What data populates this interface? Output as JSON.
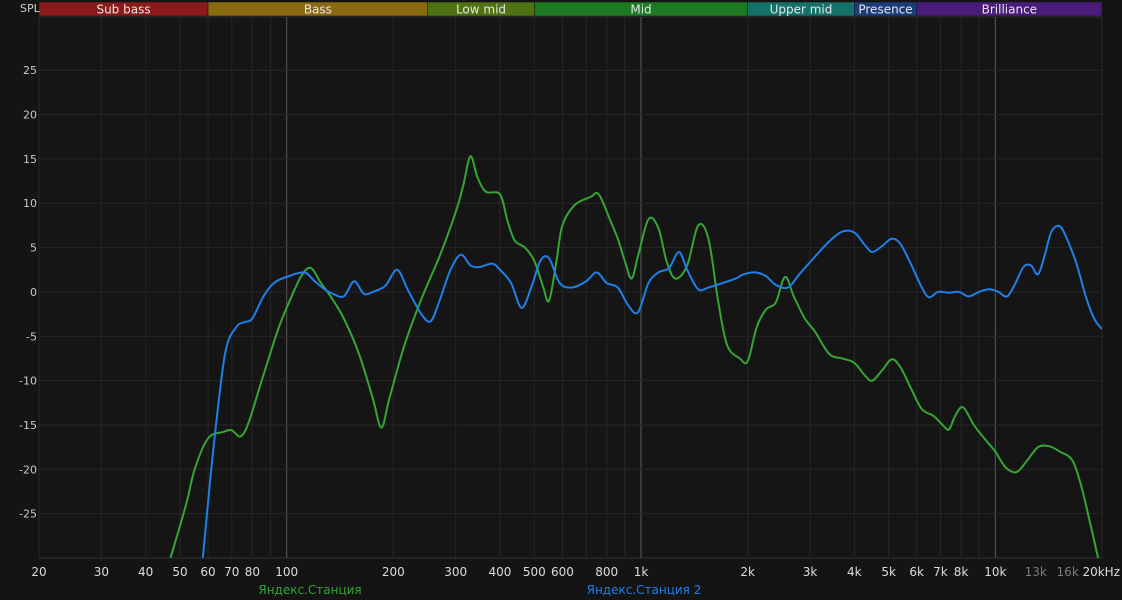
{
  "chart_data": {
    "type": "line",
    "y_axis_label": "SPL",
    "x_scale": "log",
    "x_range": [
      20,
      20000
    ],
    "y_range": [
      -30,
      31
    ],
    "y_ticks": [
      -25,
      -20,
      -15,
      -10,
      -5,
      0,
      5,
      10,
      15,
      20,
      25
    ],
    "x_ticks": [
      {
        "value": 20,
        "label": "20",
        "dim": false
      },
      {
        "value": 30,
        "label": "30",
        "dim": false
      },
      {
        "value": 40,
        "label": "40",
        "dim": false
      },
      {
        "value": 50,
        "label": "50",
        "dim": false
      },
      {
        "value": 60,
        "label": "60",
        "dim": false
      },
      {
        "value": 70,
        "label": "70",
        "dim": false
      },
      {
        "value": 80,
        "label": "80",
        "dim": false
      },
      {
        "value": 100,
        "label": "100",
        "dim": false
      },
      {
        "value": 200,
        "label": "200",
        "dim": false
      },
      {
        "value": 300,
        "label": "300",
        "dim": false
      },
      {
        "value": 400,
        "label": "400",
        "dim": false
      },
      {
        "value": 500,
        "label": "500",
        "dim": false
      },
      {
        "value": 600,
        "label": "600",
        "dim": false
      },
      {
        "value": 800,
        "label": "800",
        "dim": false
      },
      {
        "value": 1000,
        "label": "1k",
        "dim": false
      },
      {
        "value": 2000,
        "label": "2k",
        "dim": false
      },
      {
        "value": 3000,
        "label": "3k",
        "dim": false
      },
      {
        "value": 4000,
        "label": "4k",
        "dim": false
      },
      {
        "value": 5000,
        "label": "5k",
        "dim": false
      },
      {
        "value": 6000,
        "label": "6k",
        "dim": false
      },
      {
        "value": 7000,
        "label": "7k",
        "dim": false
      },
      {
        "value": 8000,
        "label": "8k",
        "dim": false
      },
      {
        "value": 10000,
        "label": "10k",
        "dim": false
      },
      {
        "value": 13000,
        "label": "13k",
        "dim": true
      },
      {
        "value": 16000,
        "label": "16k",
        "dim": true
      },
      {
        "value": 20000,
        "label": "20kHz",
        "dim": false
      }
    ],
    "major_gridlines": [
      100,
      1000,
      10000
    ],
    "bands": [
      {
        "name": "Sub bass",
        "from": 20,
        "to": 60,
        "color": "#8b1a1a"
      },
      {
        "name": "Bass",
        "from": 60,
        "to": 250,
        "color": "#8a6a10"
      },
      {
        "name": "Low mid",
        "from": 250,
        "to": 500,
        "color": "#4f7212"
      },
      {
        "name": "Mid",
        "from": 500,
        "to": 2000,
        "color": "#1d7a22"
      },
      {
        "name": "Upper mid",
        "from": 2000,
        "to": 4000,
        "color": "#16706a"
      },
      {
        "name": "Presence",
        "from": 4000,
        "to": 6000,
        "color": "#1c3c7a"
      },
      {
        "name": "Brilliance",
        "from": 6000,
        "to": 20000,
        "color": "#4a1c7a"
      }
    ],
    "series": [
      {
        "name": "Яндекс.Станция",
        "color": "#35a534",
        "points": [
          [
            47,
            -30
          ],
          [
            52,
            -24
          ],
          [
            55,
            -20
          ],
          [
            60,
            -16.5
          ],
          [
            66,
            -15.8
          ],
          [
            70,
            -15.6
          ],
          [
            74,
            -16.3
          ],
          [
            78,
            -14.8
          ],
          [
            85,
            -10
          ],
          [
            95,
            -4
          ],
          [
            102,
            -1
          ],
          [
            110,
            1.8
          ],
          [
            117,
            2.7
          ],
          [
            125,
            1
          ],
          [
            133,
            -0.5
          ],
          [
            145,
            -3
          ],
          [
            160,
            -7
          ],
          [
            175,
            -12
          ],
          [
            185,
            -15.3
          ],
          [
            195,
            -12
          ],
          [
            215,
            -6
          ],
          [
            240,
            -0.8
          ],
          [
            270,
            4
          ],
          [
            300,
            9
          ],
          [
            315,
            12
          ],
          [
            330,
            15.3
          ],
          [
            345,
            13
          ],
          [
            365,
            11.3
          ],
          [
            400,
            11
          ],
          [
            420,
            8
          ],
          [
            440,
            5.8
          ],
          [
            470,
            5
          ],
          [
            500,
            3.5
          ],
          [
            530,
            0.5
          ],
          [
            550,
            -1
          ],
          [
            575,
            3
          ],
          [
            600,
            7.5
          ],
          [
            650,
            9.8
          ],
          [
            720,
            10.7
          ],
          [
            760,
            11
          ],
          [
            820,
            8
          ],
          [
            860,
            6
          ],
          [
            900,
            3.5
          ],
          [
            940,
            1.5
          ],
          [
            980,
            4
          ],
          [
            1050,
            8.2
          ],
          [
            1120,
            7.2
          ],
          [
            1180,
            3.5
          ],
          [
            1250,
            1.5
          ],
          [
            1350,
            3
          ],
          [
            1450,
            7.5
          ],
          [
            1550,
            6
          ],
          [
            1650,
            -1
          ],
          [
            1750,
            -6
          ],
          [
            1900,
            -7.5
          ],
          [
            2000,
            -7.8
          ],
          [
            2120,
            -4
          ],
          [
            2250,
            -2
          ],
          [
            2400,
            -1.2
          ],
          [
            2550,
            1.7
          ],
          [
            2700,
            -0.5
          ],
          [
            2900,
            -3
          ],
          [
            3100,
            -4.5
          ],
          [
            3400,
            -7
          ],
          [
            3700,
            -7.5
          ],
          [
            4000,
            -8
          ],
          [
            4300,
            -9.5
          ],
          [
            4500,
            -10
          ],
          [
            4800,
            -8.8
          ],
          [
            5100,
            -7.6
          ],
          [
            5400,
            -8.5
          ],
          [
            5800,
            -11
          ],
          [
            6200,
            -13.2
          ],
          [
            6700,
            -14
          ],
          [
            7100,
            -15
          ],
          [
            7400,
            -15.5
          ],
          [
            7700,
            -14
          ],
          [
            8100,
            -13
          ],
          [
            8700,
            -15
          ],
          [
            9300,
            -16.5
          ],
          [
            10000,
            -18
          ],
          [
            10700,
            -19.8
          ],
          [
            11500,
            -20.3
          ],
          [
            12300,
            -19
          ],
          [
            13200,
            -17.5
          ],
          [
            14200,
            -17.4
          ],
          [
            15200,
            -18
          ],
          [
            16500,
            -19
          ],
          [
            17500,
            -22
          ],
          [
            18500,
            -26
          ],
          [
            19500,
            -30
          ]
        ]
      },
      {
        "name": "Яндекс.Станция 2",
        "color": "#1f7fe8",
        "points": [
          [
            58,
            -30
          ],
          [
            62,
            -18
          ],
          [
            67,
            -7
          ],
          [
            72,
            -4
          ],
          [
            76,
            -3.4
          ],
          [
            80,
            -3
          ],
          [
            86,
            -0.5
          ],
          [
            92,
            1
          ],
          [
            100,
            1.7
          ],
          [
            112,
            2.2
          ],
          [
            120,
            1.2
          ],
          [
            128,
            0.3
          ],
          [
            135,
            -0.2
          ],
          [
            145,
            -0.5
          ],
          [
            155,
            1.2
          ],
          [
            165,
            -0.2
          ],
          [
            175,
            0
          ],
          [
            190,
            0.7
          ],
          [
            205,
            2.5
          ],
          [
            220,
            0.2
          ],
          [
            240,
            -2.5
          ],
          [
            255,
            -3.3
          ],
          [
            270,
            -1
          ],
          [
            290,
            2.5
          ],
          [
            310,
            4.2
          ],
          [
            330,
            3
          ],
          [
            350,
            2.8
          ],
          [
            380,
            3.2
          ],
          [
            400,
            2.5
          ],
          [
            430,
            1
          ],
          [
            460,
            -1.8
          ],
          [
            490,
            0.5
          ],
          [
            520,
            3.5
          ],
          [
            550,
            3.8
          ],
          [
            590,
            1
          ],
          [
            640,
            0.5
          ],
          [
            700,
            1.2
          ],
          [
            750,
            2.2
          ],
          [
            800,
            1
          ],
          [
            860,
            0.5
          ],
          [
            920,
            -1.5
          ],
          [
            980,
            -2.3
          ],
          [
            1050,
            1
          ],
          [
            1120,
            2.2
          ],
          [
            1200,
            2.7
          ],
          [
            1280,
            4.5
          ],
          [
            1350,
            2.5
          ],
          [
            1450,
            0.3
          ],
          [
            1550,
            0.5
          ],
          [
            1700,
            1
          ],
          [
            1850,
            1.5
          ],
          [
            1950,
            2
          ],
          [
            2100,
            2.2
          ],
          [
            2250,
            1.8
          ],
          [
            2400,
            0.8
          ],
          [
            2600,
            0.5
          ],
          [
            2800,
            2
          ],
          [
            3100,
            4
          ],
          [
            3400,
            5.7
          ],
          [
            3700,
            6.8
          ],
          [
            4000,
            6.7
          ],
          [
            4300,
            5.2
          ],
          [
            4500,
            4.5
          ],
          [
            4800,
            5.2
          ],
          [
            5100,
            6
          ],
          [
            5400,
            5.4
          ],
          [
            5800,
            3
          ],
          [
            6200,
            0.5
          ],
          [
            6500,
            -0.6
          ],
          [
            6900,
            0
          ],
          [
            7400,
            -0.1
          ],
          [
            7900,
            0
          ],
          [
            8400,
            -0.5
          ],
          [
            9000,
            0
          ],
          [
            9600,
            0.3
          ],
          [
            10200,
            0
          ],
          [
            10800,
            -0.5
          ],
          [
            11400,
            1
          ],
          [
            12000,
            2.8
          ],
          [
            12600,
            3
          ],
          [
            13200,
            2
          ],
          [
            13800,
            4.2
          ],
          [
            14400,
            6.8
          ],
          [
            15200,
            7.4
          ],
          [
            16000,
            5.8
          ],
          [
            17000,
            3
          ],
          [
            18000,
            -0.5
          ],
          [
            19000,
            -3
          ],
          [
            20000,
            -4.2
          ]
        ]
      }
    ]
  }
}
